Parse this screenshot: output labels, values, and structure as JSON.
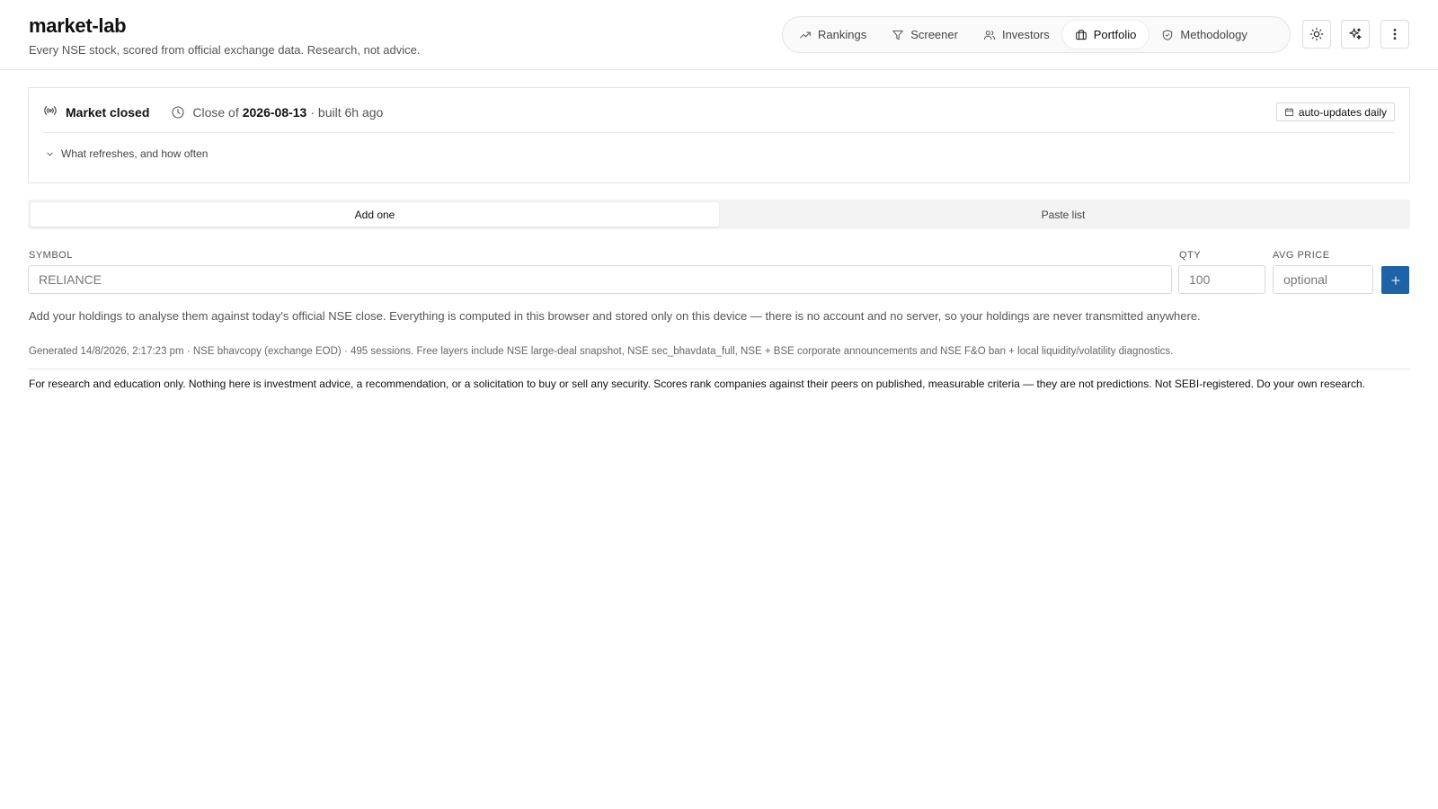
{
  "brand": {
    "title": "market-lab",
    "subtitle": "Every NSE stock, scored from official exchange data. Research, not advice."
  },
  "nav": {
    "items": [
      {
        "label": "Rankings",
        "icon": "trending-up-icon"
      },
      {
        "label": "Screener",
        "icon": "filter-icon"
      },
      {
        "label": "Investors",
        "icon": "users-icon"
      },
      {
        "label": "Portfolio",
        "icon": "briefcase-icon",
        "active": true
      },
      {
        "label": "Methodology",
        "icon": "shield-icon"
      }
    ]
  },
  "toolbar": {
    "theme_icon": "sun-icon",
    "sparkle_icon": "sparkles-icon",
    "menu_icon": "more-vertical-icon"
  },
  "status": {
    "market_state": "Market closed",
    "close_prefix": "Close of",
    "close_date": "2026-08-13",
    "built": "· built 6h ago",
    "auto_badge": "auto-updates daily",
    "refresh_toggle": "What refreshes, and how often"
  },
  "tabs": {
    "add_one": "Add one",
    "paste_list": "Paste list"
  },
  "form": {
    "symbol_label": "SYMBOL",
    "symbol_placeholder": "RELIANCE",
    "qty_label": "QTY",
    "qty_placeholder": "100",
    "avg_price_label": "AVG PRICE",
    "avg_price_placeholder": "optional"
  },
  "note": "Add your holdings to analyse them against today's official NSE close. Everything is computed in this browser and stored only on this device — there is no account and no server, so your holdings are never transmitted anywhere.",
  "generated": "Generated 14/8/2026, 2:17:23 pm · NSE bhavcopy (exchange EOD) · 495 sessions. Free layers include NSE large-deal snapshot, NSE sec_bhavdata_full, NSE + BSE corporate announcements and NSE F&O ban + local liquidity/volatility diagnostics.",
  "disclaimer": "For research and education only. Nothing here is investment advice, a recommendation, or a solicitation to buy or sell any security. Scores rank companies against their peers on published, measurable criteria — they are not predictions. Not SEBI-registered. Do your own research.",
  "colors": {
    "accent": "#1e63a8"
  }
}
